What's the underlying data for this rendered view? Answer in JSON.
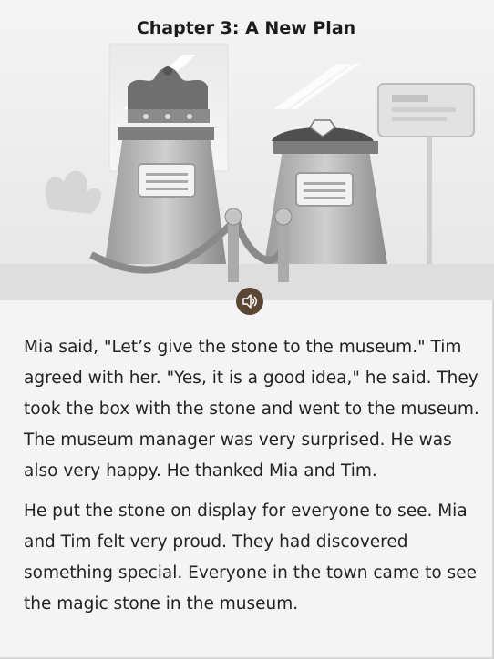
{
  "chapter": {
    "title": "Chapter 3: A New Plan"
  },
  "illustration": {
    "subject": "museum display with crown and magic stone"
  },
  "audio": {
    "icon": "speaker-icon",
    "button_color": "#5a4632"
  },
  "story": {
    "paragraphs": [
      "Mia said, \"Let’s give the stone to the museum.\" Tim agreed with her. \"Yes, it is a good idea,\" he said. They took the box with the stone and went to the museum. The museum manager was very surprised. He was also very happy. He thanked Mia and Tim.",
      "He put the stone on display for everyone to see. Mia and Tim felt very proud. They had discovered something special. Everyone in the town came to see the magic stone in the museum."
    ]
  }
}
